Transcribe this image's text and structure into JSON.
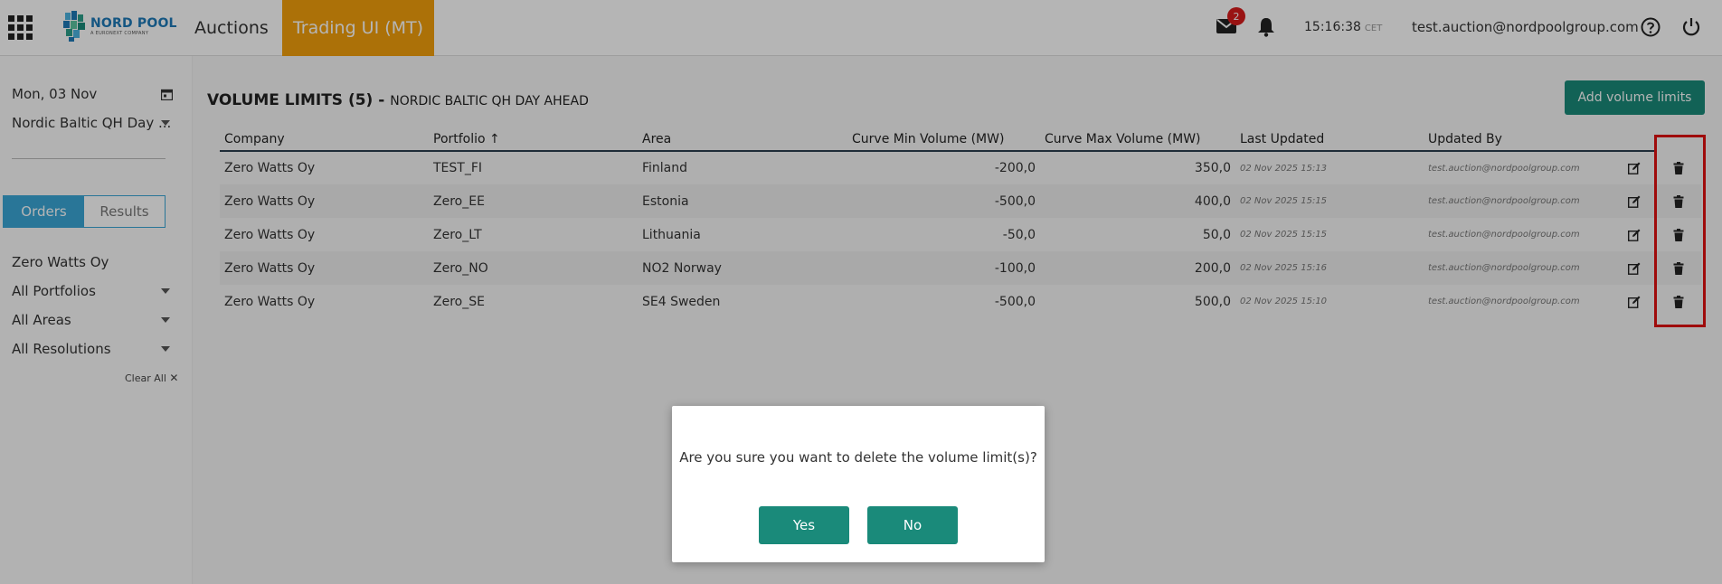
{
  "header": {
    "logo_main": "NORD POOL",
    "logo_sub": "A EURONEXT COMPANY",
    "nav": {
      "auctions": "Auctions",
      "trading": "Trading UI (MT)"
    },
    "mail_count": "2",
    "time": "15:16:38",
    "timezone": "CET",
    "user_email": "test.auction@nordpoolgroup.com",
    "accent_color": "#f3a00c"
  },
  "sidebar": {
    "date": "Mon, 03 Nov",
    "market": "Nordic Baltic QH Day ...",
    "tabs": {
      "orders": "Orders",
      "results": "Results"
    },
    "company": "Zero Watts Oy",
    "filters": {
      "portfolios": "All Portfolios",
      "areas": "All Areas",
      "resolutions": "All Resolutions"
    },
    "clear_all": "Clear All"
  },
  "main": {
    "title": "VOLUME LIMITS (5) - ",
    "subtitle": "NORDIC BALTIC QH DAY AHEAD",
    "add_button": "Add volume limits",
    "columns": {
      "company": "Company",
      "portfolio": "Portfolio",
      "area": "Area",
      "curve_min": "Curve Min Volume (MW)",
      "curve_max": "Curve Max Volume (MW)",
      "last_updated": "Last Updated",
      "updated_by": "Updated By"
    },
    "rows": [
      {
        "company": "Zero Watts Oy",
        "portfolio": "TEST_FI",
        "area": "Finland",
        "min": "-200,0",
        "max": "350,0",
        "updated": "02 Nov 2025 15:13",
        "by": "test.auction@nordpoolgroup.com"
      },
      {
        "company": "Zero Watts Oy",
        "portfolio": "Zero_EE",
        "area": "Estonia",
        "min": "-500,0",
        "max": "400,0",
        "updated": "02 Nov 2025 15:15",
        "by": "test.auction@nordpoolgroup.com"
      },
      {
        "company": "Zero Watts Oy",
        "portfolio": "Zero_LT",
        "area": "Lithuania",
        "min": "-50,0",
        "max": "50,0",
        "updated": "02 Nov 2025 15:15",
        "by": "test.auction@nordpoolgroup.com"
      },
      {
        "company": "Zero Watts Oy",
        "portfolio": "Zero_NO",
        "area": "NO2 Norway",
        "min": "-100,0",
        "max": "200,0",
        "updated": "02 Nov 2025 15:16",
        "by": "test.auction@nordpoolgroup.com"
      },
      {
        "company": "Zero Watts Oy",
        "portfolio": "Zero_SE",
        "area": "SE4 Sweden",
        "min": "-500,0",
        "max": "500,0",
        "updated": "02 Nov 2025 15:10",
        "by": "test.auction@nordpoolgroup.com"
      }
    ]
  },
  "dialog": {
    "message": "Are you sure you want to delete the volume limit(s)?",
    "yes": "Yes",
    "no": "No"
  },
  "icons": {
    "apps": "grid-icon",
    "mail": "mail-icon",
    "notifications": "bell-icon",
    "help": "help-icon",
    "logout": "power-icon",
    "calendar": "calendar-icon",
    "edit": "edit-icon",
    "delete": "trash-icon",
    "sort": "sort-asc-icon",
    "clear": "close-icon"
  }
}
